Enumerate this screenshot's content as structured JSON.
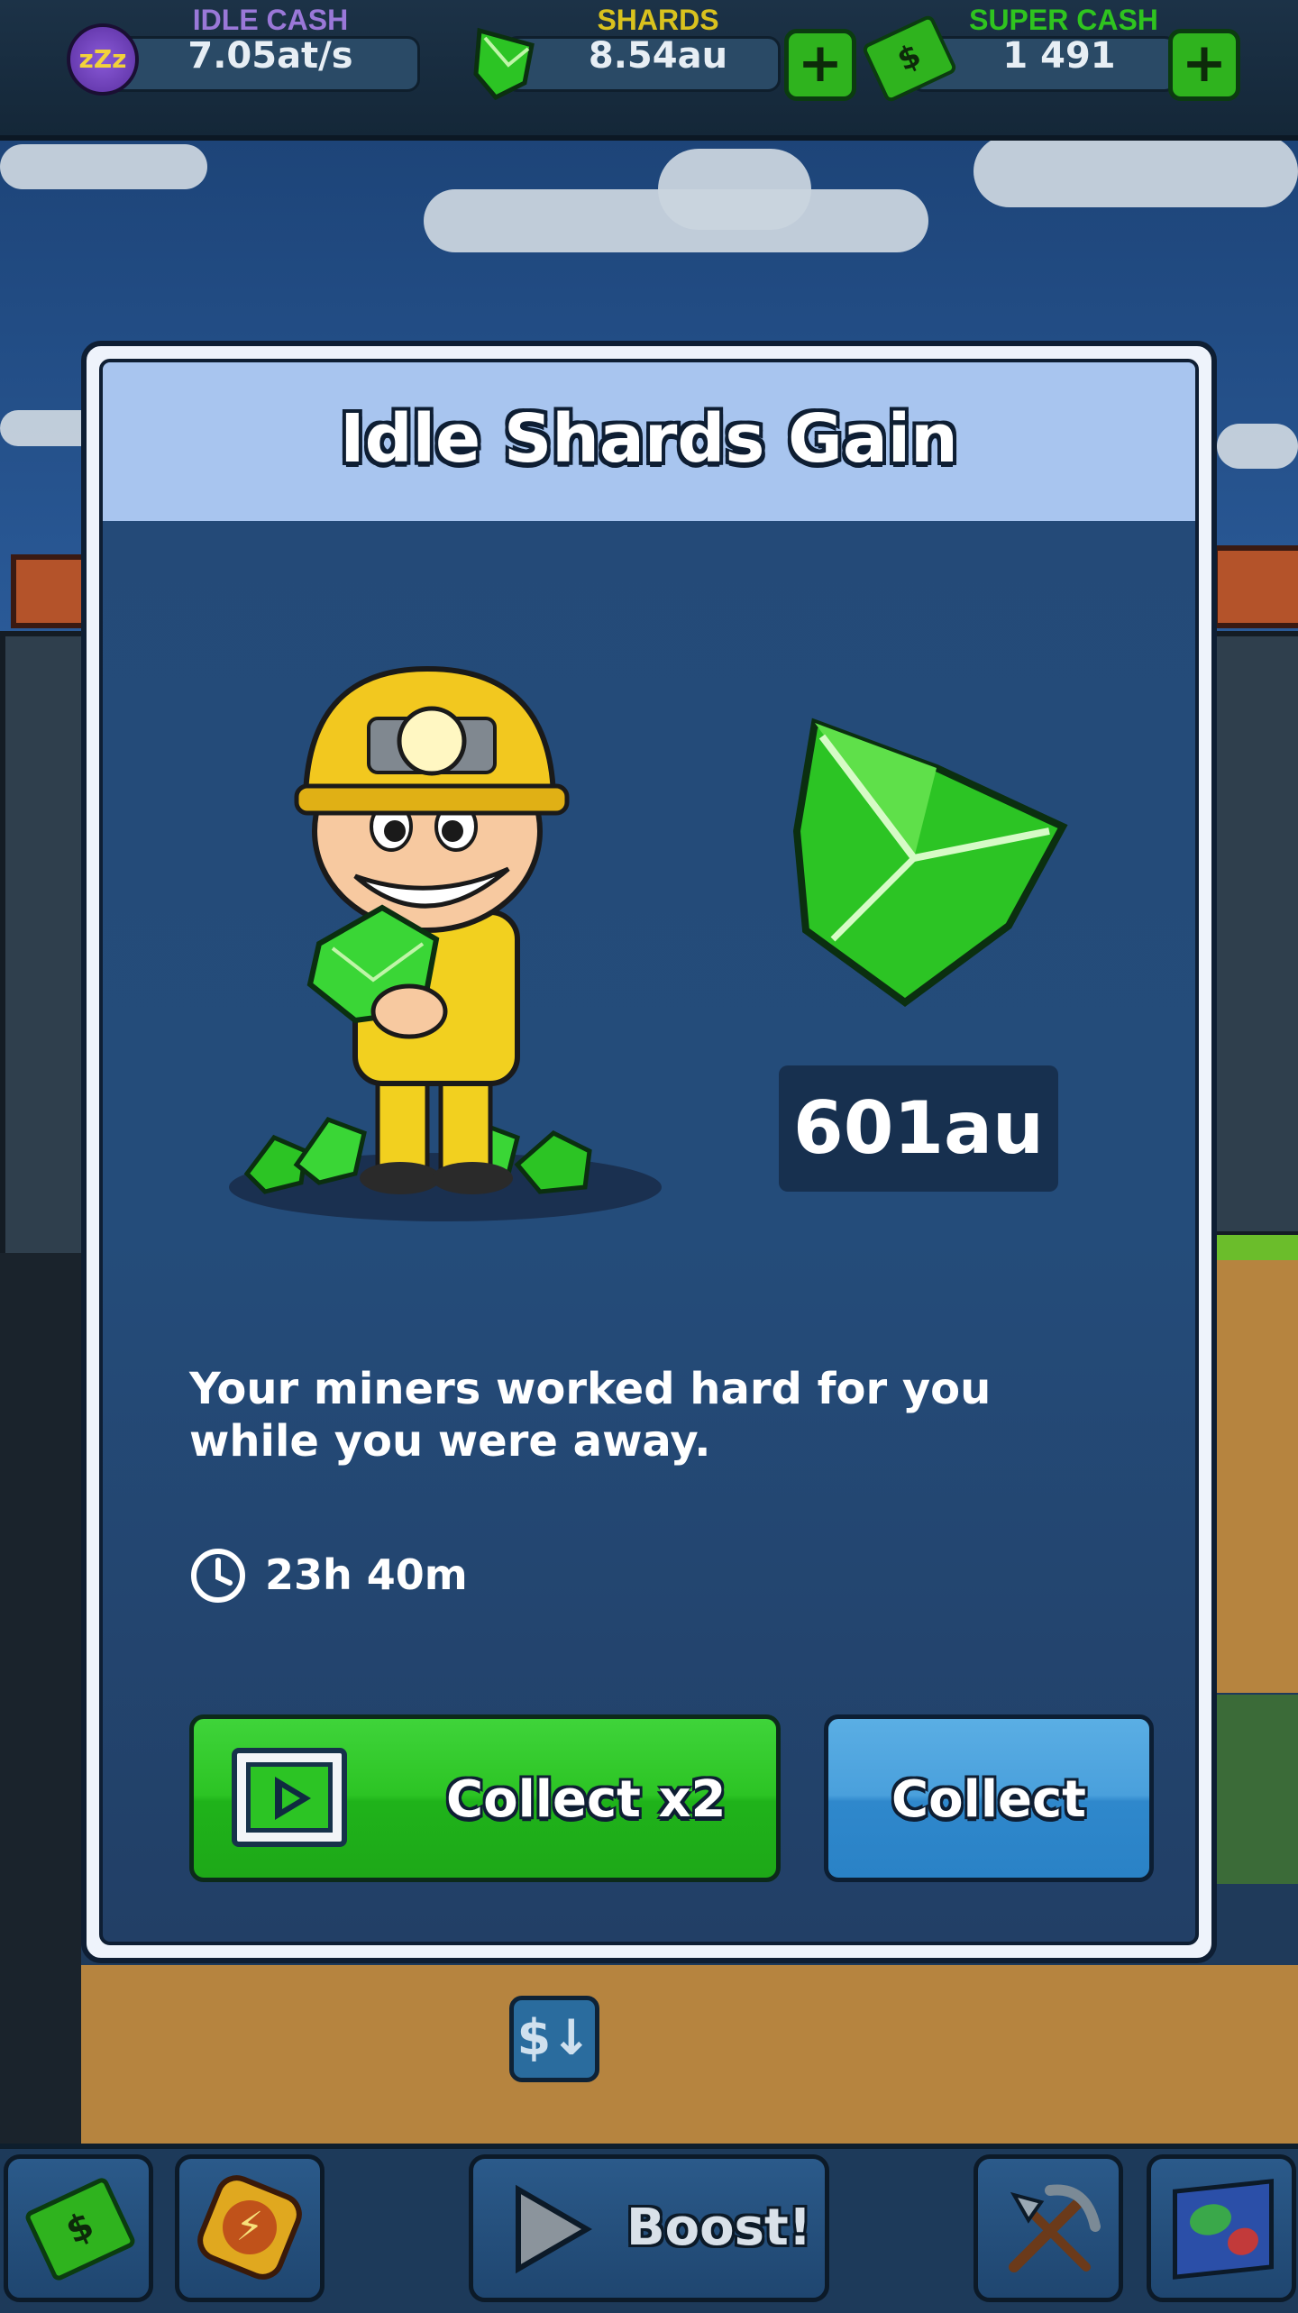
{
  "top_bar": {
    "idle_cash": {
      "title": "IDLE CASH",
      "value": "7.05at/s",
      "icon": "sleep-zzz-icon",
      "title_color": "#9a78d8"
    },
    "shards": {
      "title": "SHARDS",
      "value": "8.54au",
      "icon": "green-shard-icon",
      "title_color": "#d9c21e"
    },
    "super_cash": {
      "title": "SUPER CASH",
      "value": "1 491",
      "icon": "cash-stack-icon",
      "title_color": "#2fc41f"
    },
    "plus_label": "+"
  },
  "modal": {
    "title": "Idle Shards Gain",
    "amount": "601au",
    "message": "Your miners worked hard for you while you were away.",
    "timer": "23h 40m",
    "collect_x2_label": "Collect x2",
    "collect_label": "Collect"
  },
  "bottom_bar": {
    "boost_label": "Boost!"
  },
  "colors": {
    "accent_green": "#2cc424",
    "accent_blue": "#4aa0dc",
    "modal_header": "#a8c5ef",
    "modal_body": "#244a78"
  }
}
